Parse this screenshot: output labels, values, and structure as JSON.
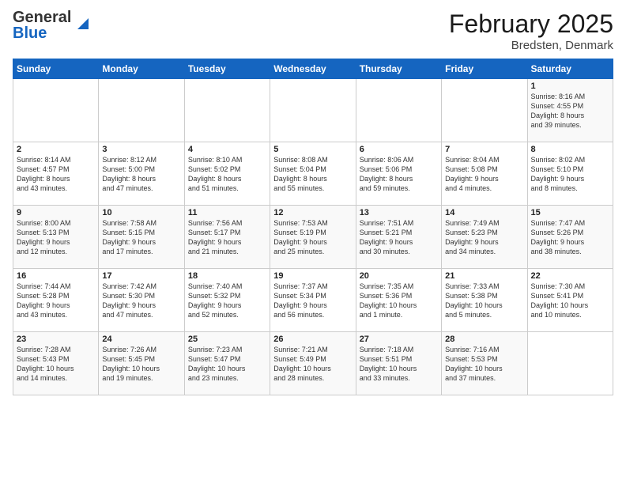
{
  "logo": {
    "line1": "General",
    "line2": "Blue"
  },
  "title": "February 2025",
  "subtitle": "Bredsten, Denmark",
  "days_header": [
    "Sunday",
    "Monday",
    "Tuesday",
    "Wednesday",
    "Thursday",
    "Friday",
    "Saturday"
  ],
  "weeks": [
    [
      {
        "day": "",
        "info": ""
      },
      {
        "day": "",
        "info": ""
      },
      {
        "day": "",
        "info": ""
      },
      {
        "day": "",
        "info": ""
      },
      {
        "day": "",
        "info": ""
      },
      {
        "day": "",
        "info": ""
      },
      {
        "day": "1",
        "info": "Sunrise: 8:16 AM\nSunset: 4:55 PM\nDaylight: 8 hours\nand 39 minutes."
      }
    ],
    [
      {
        "day": "2",
        "info": "Sunrise: 8:14 AM\nSunset: 4:57 PM\nDaylight: 8 hours\nand 43 minutes."
      },
      {
        "day": "3",
        "info": "Sunrise: 8:12 AM\nSunset: 5:00 PM\nDaylight: 8 hours\nand 47 minutes."
      },
      {
        "day": "4",
        "info": "Sunrise: 8:10 AM\nSunset: 5:02 PM\nDaylight: 8 hours\nand 51 minutes."
      },
      {
        "day": "5",
        "info": "Sunrise: 8:08 AM\nSunset: 5:04 PM\nDaylight: 8 hours\nand 55 minutes."
      },
      {
        "day": "6",
        "info": "Sunrise: 8:06 AM\nSunset: 5:06 PM\nDaylight: 8 hours\nand 59 minutes."
      },
      {
        "day": "7",
        "info": "Sunrise: 8:04 AM\nSunset: 5:08 PM\nDaylight: 9 hours\nand 4 minutes."
      },
      {
        "day": "8",
        "info": "Sunrise: 8:02 AM\nSunset: 5:10 PM\nDaylight: 9 hours\nand 8 minutes."
      }
    ],
    [
      {
        "day": "9",
        "info": "Sunrise: 8:00 AM\nSunset: 5:13 PM\nDaylight: 9 hours\nand 12 minutes."
      },
      {
        "day": "10",
        "info": "Sunrise: 7:58 AM\nSunset: 5:15 PM\nDaylight: 9 hours\nand 17 minutes."
      },
      {
        "day": "11",
        "info": "Sunrise: 7:56 AM\nSunset: 5:17 PM\nDaylight: 9 hours\nand 21 minutes."
      },
      {
        "day": "12",
        "info": "Sunrise: 7:53 AM\nSunset: 5:19 PM\nDaylight: 9 hours\nand 25 minutes."
      },
      {
        "day": "13",
        "info": "Sunrise: 7:51 AM\nSunset: 5:21 PM\nDaylight: 9 hours\nand 30 minutes."
      },
      {
        "day": "14",
        "info": "Sunrise: 7:49 AM\nSunset: 5:23 PM\nDaylight: 9 hours\nand 34 minutes."
      },
      {
        "day": "15",
        "info": "Sunrise: 7:47 AM\nSunset: 5:26 PM\nDaylight: 9 hours\nand 38 minutes."
      }
    ],
    [
      {
        "day": "16",
        "info": "Sunrise: 7:44 AM\nSunset: 5:28 PM\nDaylight: 9 hours\nand 43 minutes."
      },
      {
        "day": "17",
        "info": "Sunrise: 7:42 AM\nSunset: 5:30 PM\nDaylight: 9 hours\nand 47 minutes."
      },
      {
        "day": "18",
        "info": "Sunrise: 7:40 AM\nSunset: 5:32 PM\nDaylight: 9 hours\nand 52 minutes."
      },
      {
        "day": "19",
        "info": "Sunrise: 7:37 AM\nSunset: 5:34 PM\nDaylight: 9 hours\nand 56 minutes."
      },
      {
        "day": "20",
        "info": "Sunrise: 7:35 AM\nSunset: 5:36 PM\nDaylight: 10 hours\nand 1 minute."
      },
      {
        "day": "21",
        "info": "Sunrise: 7:33 AM\nSunset: 5:38 PM\nDaylight: 10 hours\nand 5 minutes."
      },
      {
        "day": "22",
        "info": "Sunrise: 7:30 AM\nSunset: 5:41 PM\nDaylight: 10 hours\nand 10 minutes."
      }
    ],
    [
      {
        "day": "23",
        "info": "Sunrise: 7:28 AM\nSunset: 5:43 PM\nDaylight: 10 hours\nand 14 minutes."
      },
      {
        "day": "24",
        "info": "Sunrise: 7:26 AM\nSunset: 5:45 PM\nDaylight: 10 hours\nand 19 minutes."
      },
      {
        "day": "25",
        "info": "Sunrise: 7:23 AM\nSunset: 5:47 PM\nDaylight: 10 hours\nand 23 minutes."
      },
      {
        "day": "26",
        "info": "Sunrise: 7:21 AM\nSunset: 5:49 PM\nDaylight: 10 hours\nand 28 minutes."
      },
      {
        "day": "27",
        "info": "Sunrise: 7:18 AM\nSunset: 5:51 PM\nDaylight: 10 hours\nand 33 minutes."
      },
      {
        "day": "28",
        "info": "Sunrise: 7:16 AM\nSunset: 5:53 PM\nDaylight: 10 hours\nand 37 minutes."
      },
      {
        "day": "",
        "info": ""
      }
    ]
  ]
}
